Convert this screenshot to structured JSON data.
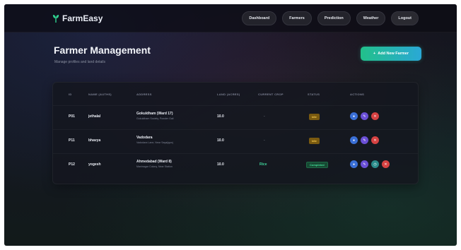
{
  "nav": {
    "brand": "FarmEasy",
    "links": [
      "Dashboard",
      "Farmers",
      "Prediction",
      "Weather"
    ],
    "logout": "Logout"
  },
  "page": {
    "title": "Farmer Management",
    "subtitle": "Manage profiles and land details",
    "add_button": "Add New Farmer"
  },
  "table": {
    "headers": [
      "ID",
      "NAME (AUTHS)",
      "ADDRESS",
      "LAND (ACRES)",
      "CURRENT CROP",
      "STATUS",
      "ACTIONS"
    ],
    "rows": [
      {
        "id": "P01",
        "name": "jethalal",
        "address_line1": "Gokuldham (Ward 17)",
        "address_line2": "Gokuldham Society, Powder Gali",
        "land": "10.0",
        "crop": "-",
        "status": "Idle"
      },
      {
        "id": "P11",
        "name": "bhavya",
        "address_line1": "Vadodara",
        "address_line2": "Vadodara Lane, Near Sayajigunj",
        "land": "10.0",
        "crop": "-",
        "status": "Idle"
      },
      {
        "id": "P12",
        "name": "yogesh",
        "address_line1": "Ahmedabad (Ward 8)",
        "address_line2": "Maninagar Colony, Near Station",
        "land": "10.0",
        "crop": "Rice",
        "status": "Completed"
      }
    ]
  },
  "colors": {
    "accent_green": "#22c08a",
    "accent_blue": "#2aa8d6",
    "badge_idle": "#f3c64a",
    "badge_completed": "#44d796"
  }
}
